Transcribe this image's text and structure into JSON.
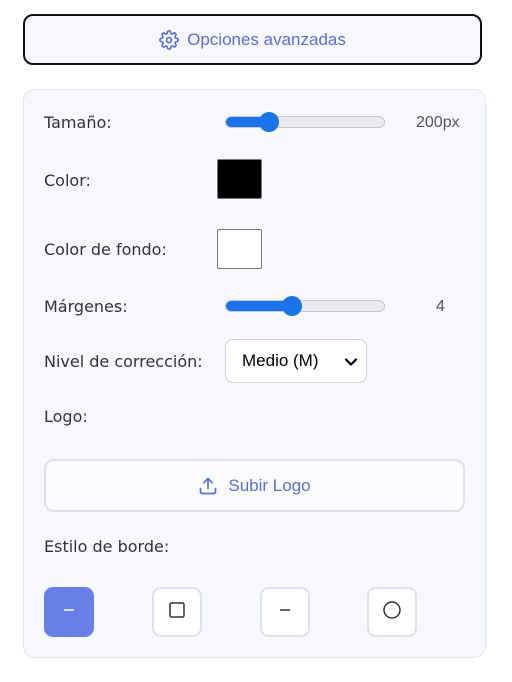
{
  "advanced_button": {
    "label": "Opciones avanzadas",
    "icon": "gear-icon"
  },
  "size": {
    "label": "Tamaño:",
    "value_text": "200px",
    "fraction": 0.27
  },
  "color": {
    "label": "Color:",
    "value": "#000000"
  },
  "background_color": {
    "label": "Color de fondo:",
    "value": "#ffffff"
  },
  "margins": {
    "label": "Márgenes:",
    "value_text": "4",
    "fraction": 0.42
  },
  "correction": {
    "label": "Nivel de corrección:",
    "selected": "Medio (M)"
  },
  "logo": {
    "label": "Logo:",
    "upload_label": "Subir Logo",
    "upload_icon": "upload-icon"
  },
  "border_style": {
    "label": "Estilo de borde:",
    "options": [
      {
        "icon": "dash-icon",
        "active": true
      },
      {
        "icon": "square-icon",
        "active": false
      },
      {
        "icon": "dash-icon",
        "active": false
      },
      {
        "icon": "circle-icon",
        "active": false
      }
    ]
  },
  "colors": {
    "accent": "#5a6fd8",
    "slider": "#1a73e8",
    "active_bg": "#6a7fe6"
  }
}
